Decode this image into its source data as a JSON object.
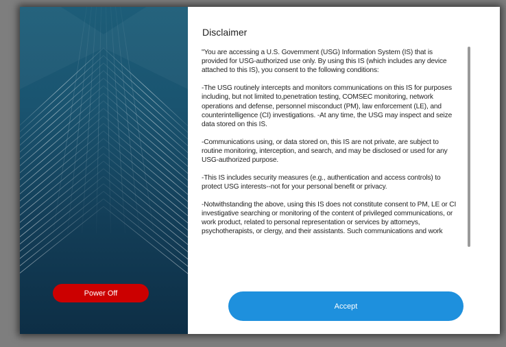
{
  "dialog": {
    "title": "Disclaimer",
    "paragraphs": [
      "\"You are accessing a U.S. Government (USG) Information System (IS) that is provided for USG-authorized use only. By using this IS (which includes any device attached to this IS), you consent to the following conditions:",
      "-The USG routinely intercepts and monitors communications on this IS for purposes including, but not limited to,penetration testing, COMSEC monitoring, network operations and defense, personnel misconduct (PM), law enforcement (LE), and counterintelligence (CI) investigations. -At any time, the USG may inspect and seize data stored on this IS.",
      "-Communications using, or data stored on, this IS are not private, are subject to routine monitoring, interception, and search, and may be disclosed or used for any USG-authorized purpose.",
      "-This IS includes security measures (e.g., authentication and access controls) to protect USG interests--not for your personal benefit or privacy.",
      "-Notwithstanding the above, using this IS does not constitute consent to PM, LE or CI investigative searching or monitoring of the content of privileged communications, or work product, related to personal representation or services by attorneys, psychotherapists, or clergy, and their assistants. Such communications and work"
    ],
    "accept_label": "Accept",
    "power_off_label": "Power Off"
  },
  "colors": {
    "accept": "#1e90dd",
    "power_off": "#cc0000",
    "panel": "#133e58"
  }
}
